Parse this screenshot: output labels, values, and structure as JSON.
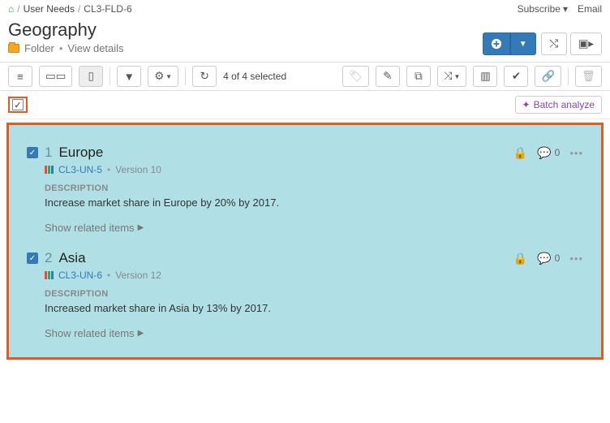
{
  "breadcrumb": {
    "parent": "User Needs",
    "current": "CL3-FLD-6"
  },
  "header": {
    "title": "Geography",
    "type_label": "Folder",
    "view_details": "View details",
    "subscribe": "Subscribe",
    "email": "Email"
  },
  "toolbar": {
    "selection": "4 of 4 selected"
  },
  "batch": {
    "label": "Batch analyze"
  },
  "desc_label": "DESCRIPTION",
  "show_related": "Show related items",
  "items": [
    {
      "num": "1",
      "title": "Europe",
      "id": "CL3-UN-5",
      "version": "Version 10",
      "description": "Increase market share in Europe by 20% by 2017.",
      "comments": "0"
    },
    {
      "num": "2",
      "title": "Asia",
      "id": "CL3-UN-6",
      "version": "Version 12",
      "description": "Increased market share in Asia by 13% by 2017.",
      "comments": "0"
    }
  ]
}
